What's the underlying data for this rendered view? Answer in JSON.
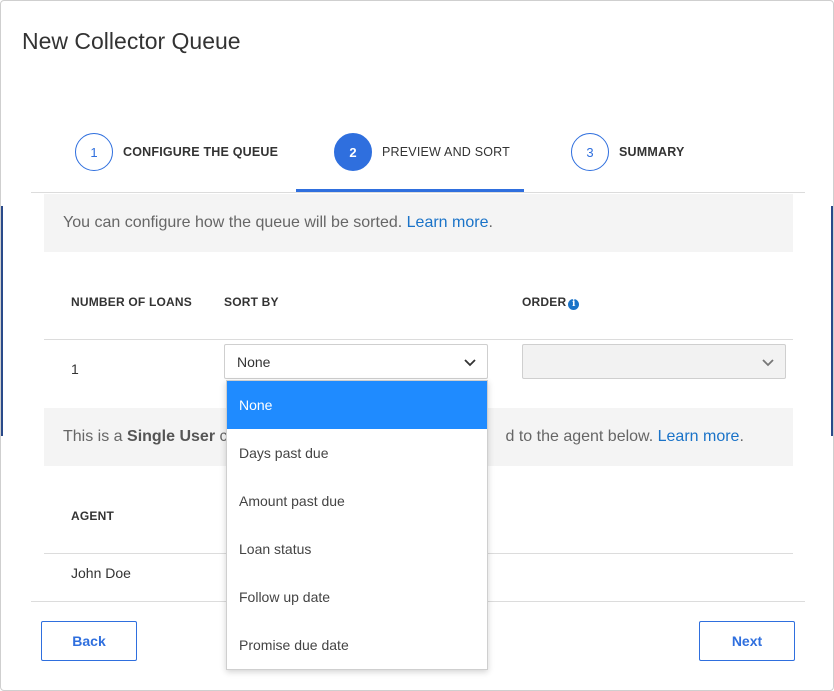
{
  "dialog": {
    "title": "New Collector Queue"
  },
  "steps": [
    {
      "number": "1",
      "label": "CONFIGURE THE QUEUE"
    },
    {
      "number": "2",
      "label": "PREVIEW AND SORT"
    },
    {
      "number": "3",
      "label": "SUMMARY"
    }
  ],
  "active_step": 2,
  "sort_info": {
    "text": "You can configure how the queue will be sorted. ",
    "link": "Learn more",
    "trail": "."
  },
  "table": {
    "headers": {
      "number_of_loans": "NUMBER OF LOANS",
      "sort_by": "SORT BY",
      "order": "ORDER"
    },
    "row": {
      "number_of_loans": "1",
      "sort_by": "None",
      "order": ""
    }
  },
  "sort_options": [
    "None",
    "Days past due",
    "Amount past due",
    "Loan status",
    "Follow up date",
    "Promise due date"
  ],
  "selected_sort_option": "None",
  "queue_info": {
    "prefix": "This is a ",
    "bold": "Single User",
    "visible_start": " c",
    "visible_end": "d to the agent below. ",
    "link": "Learn more",
    "trail": "."
  },
  "agents": {
    "header": "AGENT",
    "rows": [
      "John Doe"
    ]
  },
  "buttons": {
    "back": "Back",
    "next": "Next"
  },
  "colors": {
    "primary": "#2f6fde",
    "link": "#1a73c8",
    "selected_option": "#1f8bff"
  }
}
